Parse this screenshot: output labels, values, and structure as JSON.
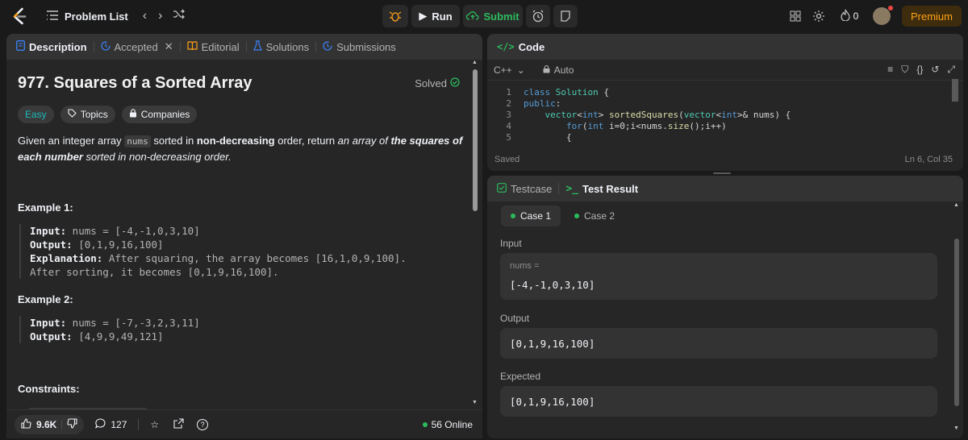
{
  "topbar": {
    "problem_list": "Problem List",
    "run": "Run",
    "submit": "Submit",
    "streak_count": "0",
    "premium": "Premium"
  },
  "left_tabs": [
    "Description",
    "Accepted",
    "Editorial",
    "Solutions",
    "Submissions"
  ],
  "problem": {
    "title": "977. Squares of a Sorted Array",
    "solved": "Solved",
    "difficulty": "Easy",
    "topics": "Topics",
    "companies": "Companies",
    "stmt_1": "Given an integer array ",
    "stmt_code": "nums",
    "stmt_2": " sorted in ",
    "stmt_bold_1": "non-decreasing",
    "stmt_3": " order, return ",
    "stmt_em_1": "an array of ",
    "stmt_em_bold": "the squares of each number",
    "stmt_em_2": " sorted in non-decreasing order.",
    "example1_title": "Example 1:",
    "ex1_input_label": "Input:",
    "ex1_input": " nums = [-4,-1,0,3,10]",
    "ex1_output_label": "Output:",
    "ex1_output": " [0,1,9,16,100]",
    "ex1_expl_label": "Explanation:",
    "ex1_expl_1": " After squaring, the array becomes [16,1,0,9,100].",
    "ex1_expl_2": "After sorting, it becomes [0,1,9,16,100].",
    "example2_title": "Example 2:",
    "ex2_input_label": "Input:",
    "ex2_input": " nums = [-7,-3,2,3,11]",
    "ex2_output_label": "Output:",
    "ex2_output": " [4,9,9,49,121]",
    "constraints_title": "Constraints:"
  },
  "left_bottom": {
    "likes": "9.6K",
    "comments": "127",
    "online": "56 Online"
  },
  "code_panel": {
    "title": "Code",
    "language": "C++",
    "auto": "Auto",
    "saved": "Saved",
    "cursor": "Ln 6, Col 35",
    "line_numbers": [
      "1",
      "2",
      "3",
      "4",
      "5"
    ]
  },
  "test_panel": {
    "testcase_tab": "Testcase",
    "result_tab": "Test Result",
    "case1": "Case 1",
    "case2": "Case 2",
    "input_label": "Input",
    "nums_label": "nums =",
    "input_value": "[-4,-1,0,3,10]",
    "output_label": "Output",
    "output_value": "[0,1,9,16,100]",
    "expected_label": "Expected",
    "expected_value": "[0,1,9,16,100]"
  },
  "colors": {
    "accent_orange": "#ffa116",
    "submit_green": "#2cbb5d",
    "easy_teal": "#1cbaba",
    "link_blue": "#3b82f6"
  }
}
